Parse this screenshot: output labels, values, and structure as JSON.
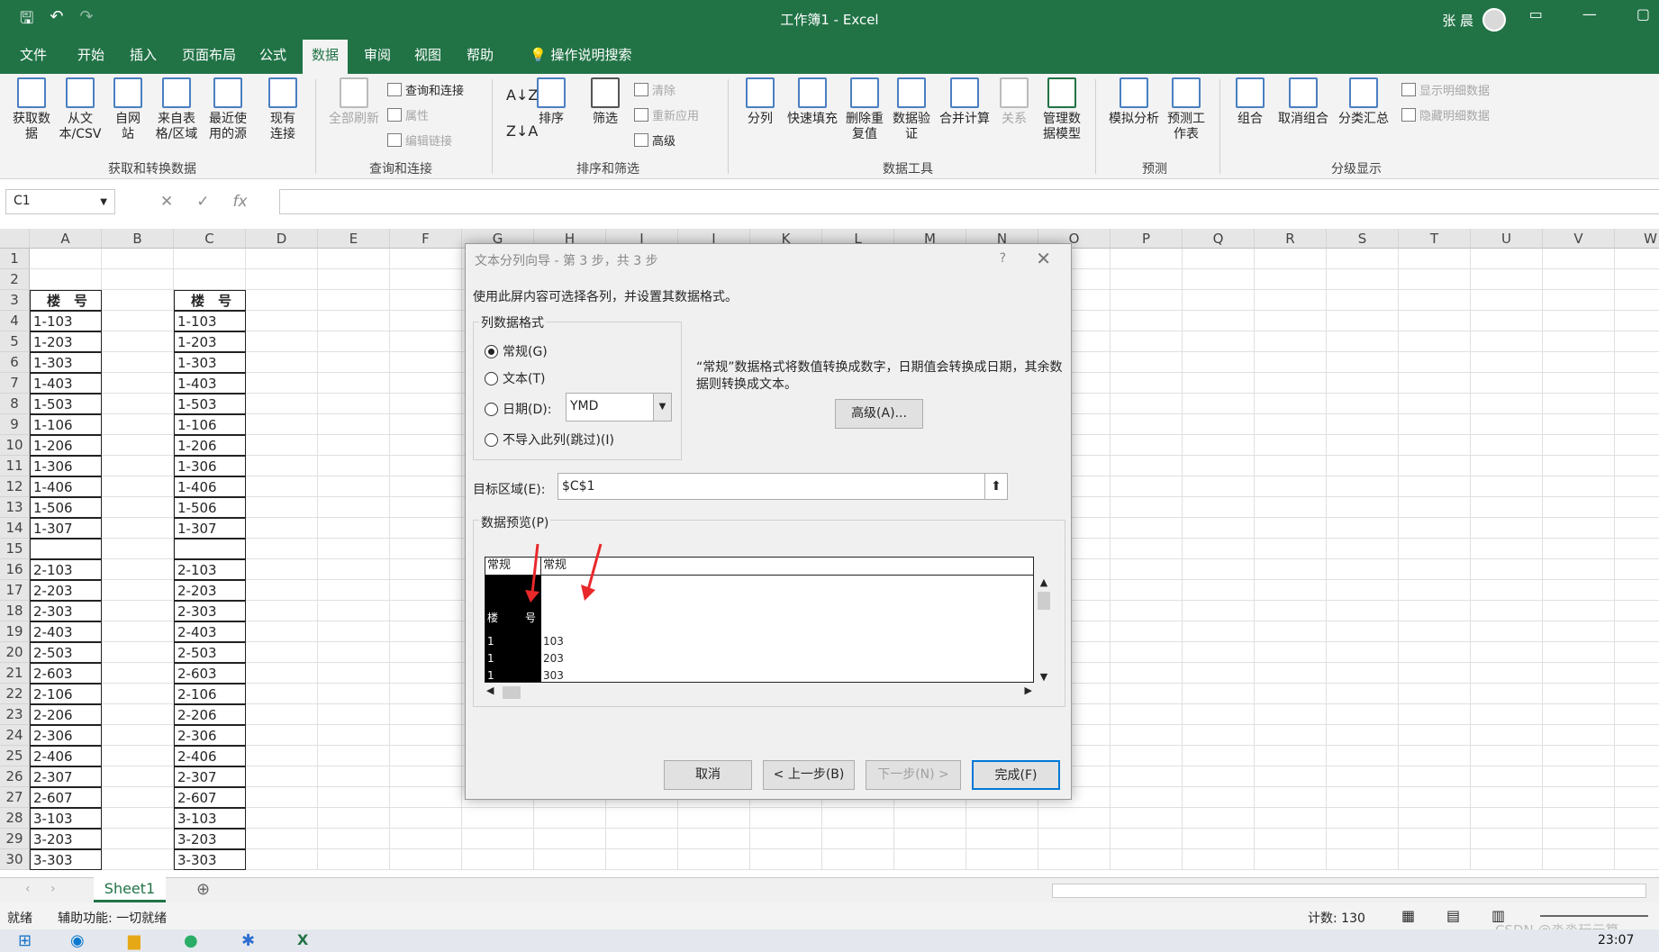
{
  "app": {
    "title": "工作簿1 - Excel",
    "user": "张 晨",
    "qat": [
      "save-icon",
      "undo-icon",
      "redo-icon"
    ]
  },
  "menu": [
    "文件",
    "开始",
    "插入",
    "页面布局",
    "公式",
    "数据",
    "审阅",
    "视图",
    "帮助",
    "操作说明搜索"
  ],
  "ribbon": {
    "get_data": "获取数据",
    "from_csv": "从文本/CSV",
    "from_web": "自网站",
    "from_table": "来自表格/区域",
    "recent": "最近使用的源",
    "existing": "现有连接",
    "grp1": "获取和转换数据",
    "refresh_all": "全部刷新",
    "queries": "查询和连接",
    "properties": "属性",
    "edit_links": "编辑链接",
    "grp2": "查询和连接",
    "sort": "排序",
    "filter": "筛选",
    "clear": "清除",
    "reapply": "重新应用",
    "advanced": "高级",
    "grp3": "排序和筛选",
    "split": "分列",
    "flash_fill": "快速填充",
    "remove_dup": "删除重复值",
    "validation": "数据验证",
    "consolidate": "合并计算",
    "relations": "关系",
    "data_model": "管理数据模型",
    "grp4": "数据工具",
    "whatif": "模拟分析",
    "forecast": "预测工作表",
    "grp5": "预测",
    "group": "组合",
    "ungroup": "取消组合",
    "subtotal": "分类汇总",
    "show_detail": "显示明细数据",
    "hide_detail": "隐藏明细数据",
    "grp6": "分级显示"
  },
  "formula": {
    "namebox": "C1",
    "fx": "fx"
  },
  "columns": [
    "A",
    "B",
    "C",
    "D",
    "E",
    "F",
    "G",
    "H",
    "I",
    "J",
    "K",
    "L",
    "M",
    "N",
    "O",
    "P",
    "Q",
    "R",
    "S",
    "T",
    "U",
    "V",
    "W"
  ],
  "rows": [
    "1",
    "2",
    "3",
    "4",
    "5",
    "6",
    "7",
    "8",
    "9",
    "10",
    "11",
    "12",
    "13",
    "14",
    "15",
    "16",
    "17",
    "18",
    "19",
    "20",
    "21",
    "22",
    "23",
    "24",
    "25",
    "26",
    "27",
    "28",
    "29",
    "30"
  ],
  "colA": [
    "",
    "",
    "楼　号",
    "1-103",
    "1-203",
    "1-303",
    "1-403",
    "1-503",
    "1-106",
    "1-206",
    "1-306",
    "1-406",
    "1-506",
    "1-307",
    "",
    "2-103",
    "2-203",
    "2-303",
    "2-403",
    "2-503",
    "2-603",
    "2-106",
    "2-206",
    "2-306",
    "2-406",
    "2-307",
    "2-607",
    "3-103",
    "3-203",
    "3-303"
  ],
  "colC": [
    "",
    "",
    "楼　号",
    "1-103",
    "1-203",
    "1-303",
    "1-403",
    "1-503",
    "1-106",
    "1-206",
    "1-306",
    "1-406",
    "1-506",
    "1-307",
    "",
    "2-103",
    "2-203",
    "2-303",
    "2-403",
    "2-503",
    "2-603",
    "2-106",
    "2-206",
    "2-306",
    "2-406",
    "2-307",
    "2-607",
    "3-103",
    "3-203",
    "3-303"
  ],
  "sheet": {
    "tab": "Sheet1"
  },
  "status": {
    "ready": "就绪",
    "accessibility": "辅助功能: 一切就绪",
    "count": "计数: 130",
    "watermark": "CSDN @淼淼玩云算",
    "time": "23:07"
  },
  "dialog": {
    "title": "文本分列向导 - 第 3 步，共 3 步",
    "help": "?",
    "intro": "使用此屏内容可选择各列，并设置其数据格式。",
    "fmt_legend": "列数据格式",
    "opt_general": "常规(G)",
    "opt_text": "文本(T)",
    "opt_date": "日期(D):",
    "date_value": "YMD",
    "opt_skip": "不导入此列(跳过)(I)",
    "desc": "“常规”数据格式将数值转换成数字，日期值会转换成日期，其余数据则转换成文本。",
    "advanced_btn": "高级(A)...",
    "dest_label": "目标区域(E):",
    "dest_value": "$C$1",
    "preview_label": "数据预览(P)",
    "preview_col1": "常规",
    "preview_col2": "常规",
    "preview_rows": [
      [
        "楼",
        "号"
      ],
      [
        "1",
        "103"
      ],
      [
        "1",
        "203"
      ],
      [
        "1",
        "303"
      ]
    ],
    "cancel": "取消",
    "back": "< 上一步(B)",
    "next": "下一步(N) >",
    "finish": "完成(F)"
  }
}
